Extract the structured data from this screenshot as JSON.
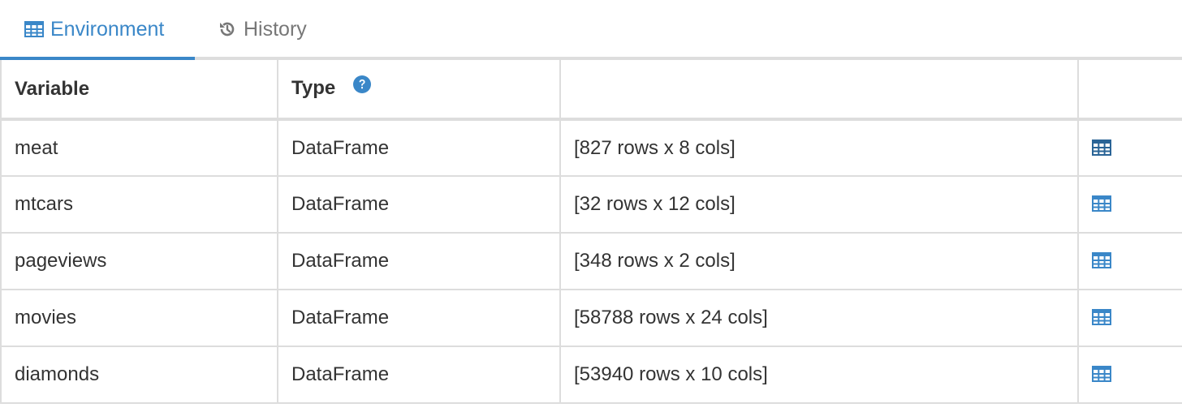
{
  "tabs": [
    {
      "label": "Environment",
      "icon": "table-icon",
      "active": true
    },
    {
      "label": "History",
      "icon": "history-icon",
      "active": false
    }
  ],
  "table": {
    "headers": {
      "variable": "Variable",
      "type": "Type",
      "summary": "",
      "action": ""
    },
    "rows": [
      {
        "variable": "meat",
        "type": "DataFrame",
        "summary": "[827 rows x 8 cols]"
      },
      {
        "variable": "mtcars",
        "type": "DataFrame",
        "summary": "[32 rows x 12 cols]"
      },
      {
        "variable": "pageviews",
        "type": "DataFrame",
        "summary": "[348 rows x 2 cols]"
      },
      {
        "variable": "movies",
        "type": "DataFrame",
        "summary": "[58788 rows x 24 cols]"
      },
      {
        "variable": "diamonds",
        "type": "DataFrame",
        "summary": "[53940 rows x 10 cols]"
      }
    ]
  },
  "colors": {
    "accent": "#3a87c8",
    "accent_dark": "#2a6496",
    "border": "#dddddd",
    "text": "#333333",
    "muted": "#777777"
  }
}
